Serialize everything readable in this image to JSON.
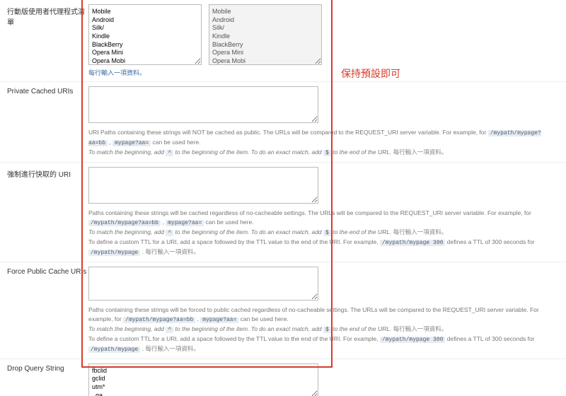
{
  "rows": {
    "mobile_ua": {
      "label": "行動版使用者代理程式清單",
      "editable_value": "Mobile\nAndroid\nSilk/\nKindle\nBlackBerry\nOpera Mini\nOpera Mobi",
      "readonly_value": "Mobile\nAndroid\nSilk/\nKindle\nBlackBerry\nOpera Mini\nOpera Mobi",
      "hint": "每行輸入一項資料。"
    },
    "private_cached": {
      "label": "Private Cached URIs",
      "help1a": "URI Paths containing these strings will NOT be cached as public. The URLs will be compared to the REQUEST_URI server variable. For example, for ",
      "code1": "/mypath/mypage?aa=bb",
      "help1b": ", ",
      "code2": "mypage?aa=",
      "help1c": " can be used here.",
      "help2a": "To match the beginning, add ",
      "code3": "^",
      "help2b": " to the beginning of the item. To do an exact match, add ",
      "code4": "$",
      "help2c": " to the end of the URL. ",
      "zh": "每行輸入一項資料。"
    },
    "forced_cache": {
      "label": "強制進行快取的 URI",
      "help1a": "Paths containing these strings will be cached regardless of no-cacheable settings. The URLs will be compared to the REQUEST_URI server variable. For example, for ",
      "code1": "/mypath/mypage?aa=bb",
      "help1b": ", ",
      "code2": "mypage?aa=",
      "help1c": " can be used here.",
      "help2a": "To match the beginning, add ",
      "code3": "^",
      "help2b": " to the beginning of the item. To do an exact match, add ",
      "code4": "$",
      "help2c": " to the end of the URL. ",
      "zh2": "每行輸入一項資料。",
      "help3a": "To define a custom TTL for a URI, add a space followed by the TTL value to the end of the URI. For example, ",
      "code5": "/mypath/mypage 300",
      "help3b": " defines a TTL of 300 seconds for ",
      "code6": "/mypath/mypage",
      "help3c": ". ",
      "zh3": "每行輸入一項資料。"
    },
    "force_public": {
      "label": "Force Public Cache URIs",
      "help1a": "Paths containing these strings will be forced to public cached regardless of no-cacheable settings. The URLs will be compared to the REQUEST_URI server variable. For example, for ",
      "code1": "/mypath/mypage?aa=bb",
      "help1b": ", ",
      "code2": "mypage?aa=",
      "help1c": " can be used here.",
      "help2a": "To match the beginning, add ",
      "code3": "^",
      "help2b": " to the beginning of the item. To do an exact match, add ",
      "code4": "$",
      "help2c": " to the end of the URL. ",
      "zh2": "每行輸入一項資料。",
      "help3a": "To define a custom TTL for a URI, add a space followed by the TTL value to the end of the URI. For example, ",
      "code5": "/mypath/mypage 300",
      "help3b": " defines a TTL of 300 seconds for ",
      "code6": "/mypath/mypage",
      "help3c": ". ",
      "zh3": "每行輸入一項資料。"
    },
    "drop_qs": {
      "label": "Drop Query String",
      "value": "fbclid\ngclid\nutm*\n_ga"
    }
  },
  "annotation": "保持預設即可"
}
